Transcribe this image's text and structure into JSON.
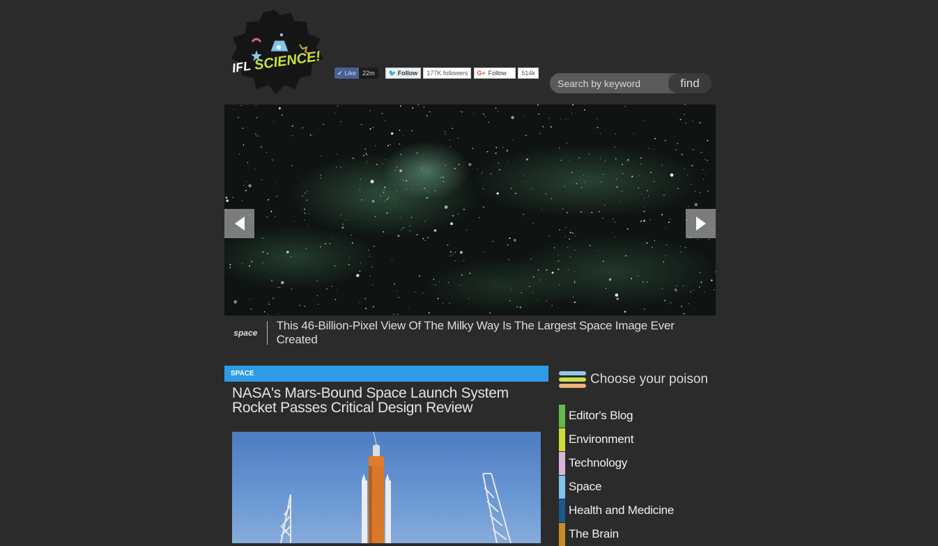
{
  "logo": {
    "text_ifl": "IFL",
    "text_science": "SCIENCE!"
  },
  "social": {
    "facebook_label": "Like",
    "facebook_count": "22m",
    "twitter_label": "Follow",
    "twitter_count": "177K followers",
    "gplus_label": "Follow",
    "gplus_count": "514k"
  },
  "search": {
    "placeholder": "Search by keyword",
    "button_label": "find"
  },
  "hero": {
    "category": "space",
    "title": "This 46-Billion-Pixel View Of The Milky Way Is The Largest Space Image Ever Created"
  },
  "article": {
    "category": "SPACE",
    "title": "NASA's Mars-Bound Space Launch System Rocket Passes Critical Design Review"
  },
  "sidebar": {
    "title": "Choose your poison",
    "icon_colors": [
      "#8fc7ee",
      "#cbe04a",
      "#f1b07c"
    ],
    "categories": [
      {
        "label": "Editor's Blog",
        "color": "#66b84a"
      },
      {
        "label": "Environment",
        "color": "#cddc39"
      },
      {
        "label": "Technology",
        "color": "#d8b7d6"
      },
      {
        "label": "Space",
        "color": "#7fc3ec"
      },
      {
        "label": "Health and Medicine",
        "color": "#1a5a8f"
      },
      {
        "label": "The Brain",
        "color": "#c98a2a"
      }
    ]
  }
}
